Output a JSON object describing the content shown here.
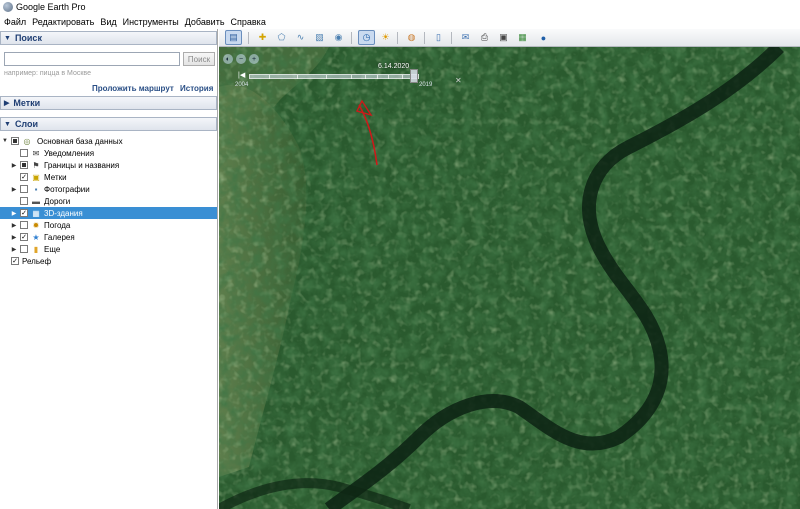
{
  "window": {
    "title": "Google Earth Pro"
  },
  "menu": [
    "Файл",
    "Редактировать",
    "Вид",
    "Инструменты",
    "Добавить",
    "Справка"
  ],
  "search": {
    "header": "Поиск",
    "placeholder": "",
    "button": "Поиск",
    "hint": "например: пицца в Москве",
    "route_link": "Проложить маршрут",
    "history_link": "История"
  },
  "places": {
    "header": "Метки"
  },
  "layers": {
    "header": "Слои",
    "items": [
      {
        "label": "Основная база данных",
        "icon": "globe-layers-icon",
        "state": "partial",
        "expander": "open",
        "selected": false
      },
      {
        "label": "Уведомления",
        "icon": "envelope-icon",
        "state": "unchecked",
        "expander": "",
        "selected": false
      },
      {
        "label": "Границы и названия",
        "icon": "flag-icon",
        "state": "partial",
        "expander": "closed",
        "selected": false
      },
      {
        "label": "Метки",
        "icon": "placemark-icon",
        "state": "checked",
        "expander": "",
        "selected": false
      },
      {
        "label": "Фотографии",
        "icon": "photo-icon",
        "state": "unchecked",
        "expander": "closed",
        "selected": false
      },
      {
        "label": "Дороги",
        "icon": "road-icon",
        "state": "unchecked",
        "expander": "",
        "selected": false
      },
      {
        "label": "3D-здания",
        "icon": "buildings-icon",
        "state": "checked",
        "expander": "closed",
        "selected": true
      },
      {
        "label": "Погода",
        "icon": "sun-icon",
        "state": "unchecked",
        "expander": "closed",
        "selected": false
      },
      {
        "label": "Галерея",
        "icon": "star-icon",
        "state": "checked",
        "expander": "closed",
        "selected": false
      },
      {
        "label": "Еще",
        "icon": "folder-icon",
        "state": "unchecked",
        "expander": "closed",
        "selected": false
      },
      {
        "label": "Рельеф",
        "icon": "",
        "state": "checked",
        "expander": "",
        "selected": false
      }
    ]
  },
  "toolbar": {
    "buttons": [
      {
        "icon": "sidebar-toggle-icon",
        "active": true
      },
      {
        "icon": "add-placemark-icon",
        "active": false
      },
      {
        "icon": "add-polygon-icon",
        "active": false
      },
      {
        "icon": "add-path-icon",
        "active": false
      },
      {
        "icon": "image-overlay-icon",
        "active": false
      },
      {
        "icon": "record-tour-icon",
        "active": false
      },
      {
        "icon": "historical-imagery-icon",
        "active": true
      },
      {
        "icon": "sunlight-icon",
        "active": false
      },
      {
        "icon": "planets-icon",
        "active": false
      },
      {
        "icon": "ruler-icon",
        "active": false
      },
      {
        "icon": "email-icon",
        "active": false
      },
      {
        "icon": "print-icon",
        "active": false
      },
      {
        "icon": "save-image-icon",
        "active": false
      },
      {
        "icon": "view-in-maps-icon",
        "active": false
      },
      {
        "icon": "earth-gallery-icon",
        "active": false
      }
    ]
  },
  "time_slider": {
    "date": "6.14.2020",
    "start_year": "2004",
    "end_year": "2019",
    "position": 0.97
  }
}
